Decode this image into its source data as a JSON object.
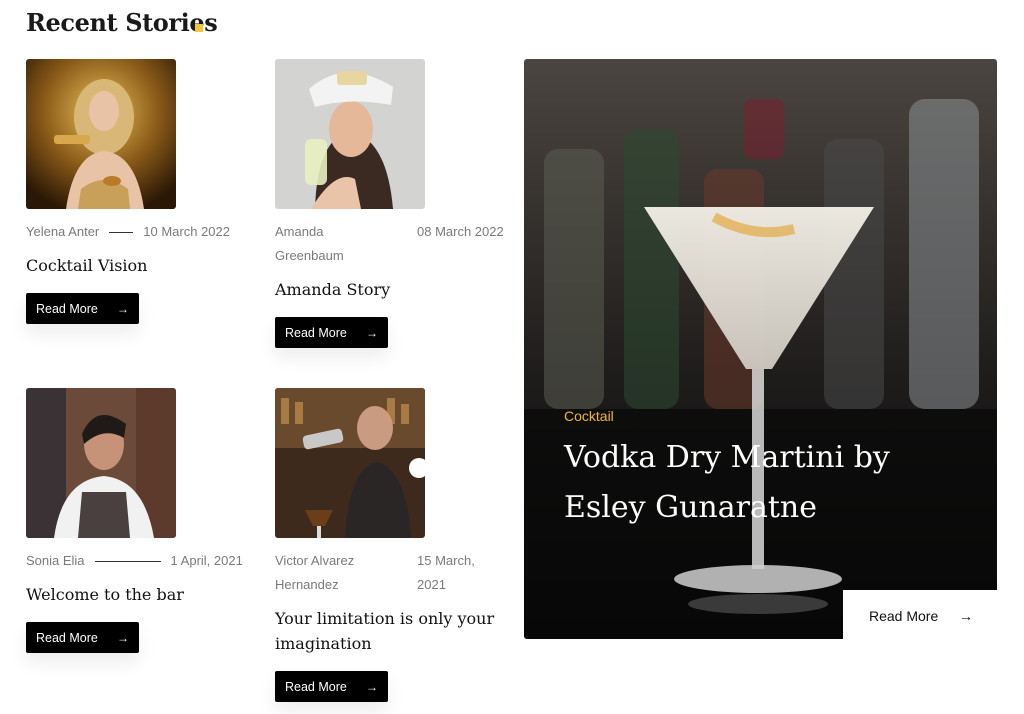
{
  "section": {
    "title": "Recent Stories"
  },
  "stories": [
    {
      "author": "Yelena Anter",
      "date": "10 March 2022",
      "title": "Cocktail Vision",
      "button": "Read More"
    },
    {
      "author": "Amanda Greenbaum",
      "date": "08 March 2022",
      "title": "Amanda Story",
      "button": "Read More"
    },
    {
      "author": "Sonia Elia",
      "date": "1 April, 2021",
      "title": "Welcome to the bar",
      "button": "Read More"
    },
    {
      "author": "Victor Alvarez Hernandez",
      "date": "15 March, 2021",
      "title": "Your limitation is only your imagination",
      "button": "Read More"
    }
  ],
  "featured": {
    "category": "Cocktail",
    "title": "Vodka Dry Martini by Esley Gunaratne",
    "button": "Read More"
  },
  "icons": {
    "button_arrow": "arrow-right-icon"
  },
  "colors": {
    "accent": "#f2c53d",
    "category": "#f2b43d",
    "button_bg": "#000000"
  }
}
